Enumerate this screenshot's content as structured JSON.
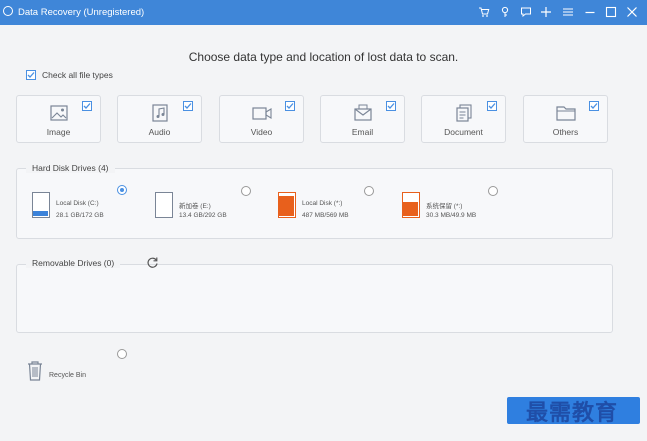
{
  "window": {
    "title": "Data Recovery (Unregistered)",
    "controls": [
      "cart-icon",
      "key-icon",
      "chat-icon",
      "plus-icon",
      "menu-icon",
      "minimize-icon",
      "maximize-icon",
      "close-icon"
    ]
  },
  "heading": "Choose data type and location of lost data to scan.",
  "check_all": {
    "label": "Check all file types",
    "checked": true
  },
  "file_types": [
    {
      "label": "Image",
      "icon": "image-icon",
      "checked": true
    },
    {
      "label": "Audio",
      "icon": "audio-icon",
      "checked": true
    },
    {
      "label": "Video",
      "icon": "video-icon",
      "checked": true
    },
    {
      "label": "Email",
      "icon": "email-icon",
      "checked": true
    },
    {
      "label": "Document",
      "icon": "document-icon",
      "checked": true
    },
    {
      "label": "Others",
      "icon": "folder-icon",
      "checked": true
    }
  ],
  "hard_disk": {
    "title": "Hard Disk Drives (4)",
    "drives": [
      {
        "name": "Local Disk (C:)",
        "size": "28.1 GB/172 GB",
        "fill": 0.16,
        "color": "#3b82d9",
        "selected": true
      },
      {
        "name": "新加卷 (E:)",
        "size": "13.4 GB/292 GB",
        "fill": 0.05,
        "color": "#3b82d9",
        "selected": false
      },
      {
        "name": "Local Disk (*:)",
        "size": "487 MB/569 MB",
        "fill": 0.86,
        "color": "#e8601c",
        "selected": false
      },
      {
        "name": "系统保留 (*:)",
        "size": "30.3 MB/49.9 MB",
        "fill": 0.61,
        "color": "#e8601c",
        "selected": false
      }
    ]
  },
  "removable": {
    "title": "Removable Drives (0)"
  },
  "recycle_bin": {
    "label": "Recycle Bin",
    "selected": false
  },
  "watermark": "最需教育",
  "colors": {
    "accent": "#3f86d8",
    "button": "#2f7fe0",
    "orange": "#e8601c"
  }
}
